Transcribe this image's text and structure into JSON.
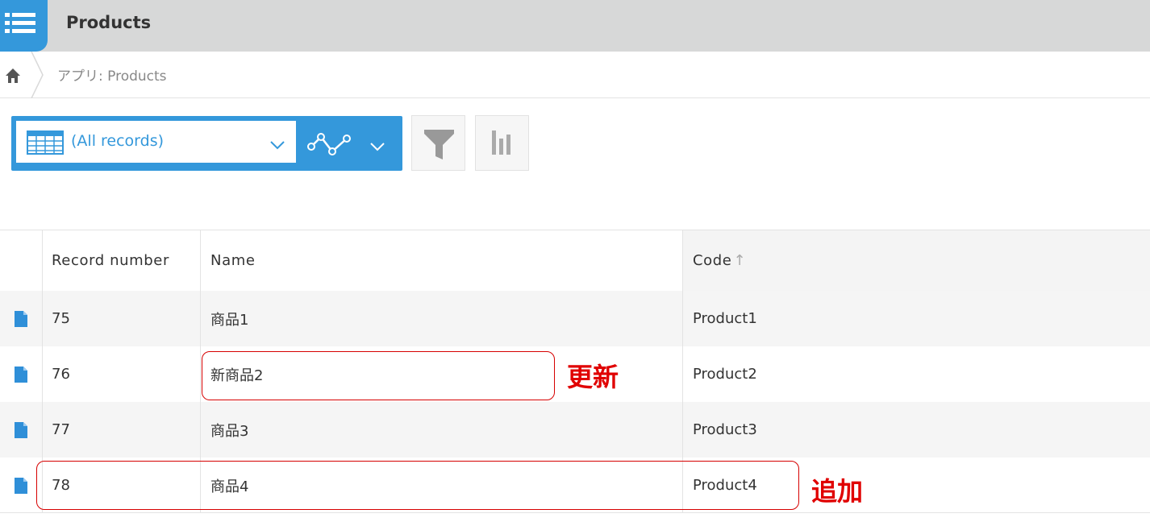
{
  "app": {
    "title": "Products"
  },
  "breadcrumb": {
    "path": "アプリ: Products"
  },
  "toolbar": {
    "view_label": "(All records)"
  },
  "table": {
    "columns": [
      "Record number",
      "Name",
      "Code"
    ],
    "sort_indicator": "↑",
    "rows": [
      {
        "record_number": "75",
        "name": "商品1",
        "code": "Product1"
      },
      {
        "record_number": "76",
        "name": "新商品2",
        "code": "Product2"
      },
      {
        "record_number": "77",
        "name": "商品3",
        "code": "Product3"
      },
      {
        "record_number": "78",
        "name": "商品4",
        "code": "Product4"
      }
    ]
  },
  "annotations": {
    "update_label": "更新",
    "add_label": "追加"
  },
  "colors": {
    "accent": "#3498db",
    "annotation": "#e00000",
    "header_bg": "#d7d8d8"
  },
  "icons": {
    "app": "list-icon",
    "home": "home-icon",
    "view": "table-icon",
    "graph": "line-graph-icon",
    "filter": "filter-funnel-icon",
    "chart": "bar-chart-icon",
    "record": "document-icon"
  }
}
